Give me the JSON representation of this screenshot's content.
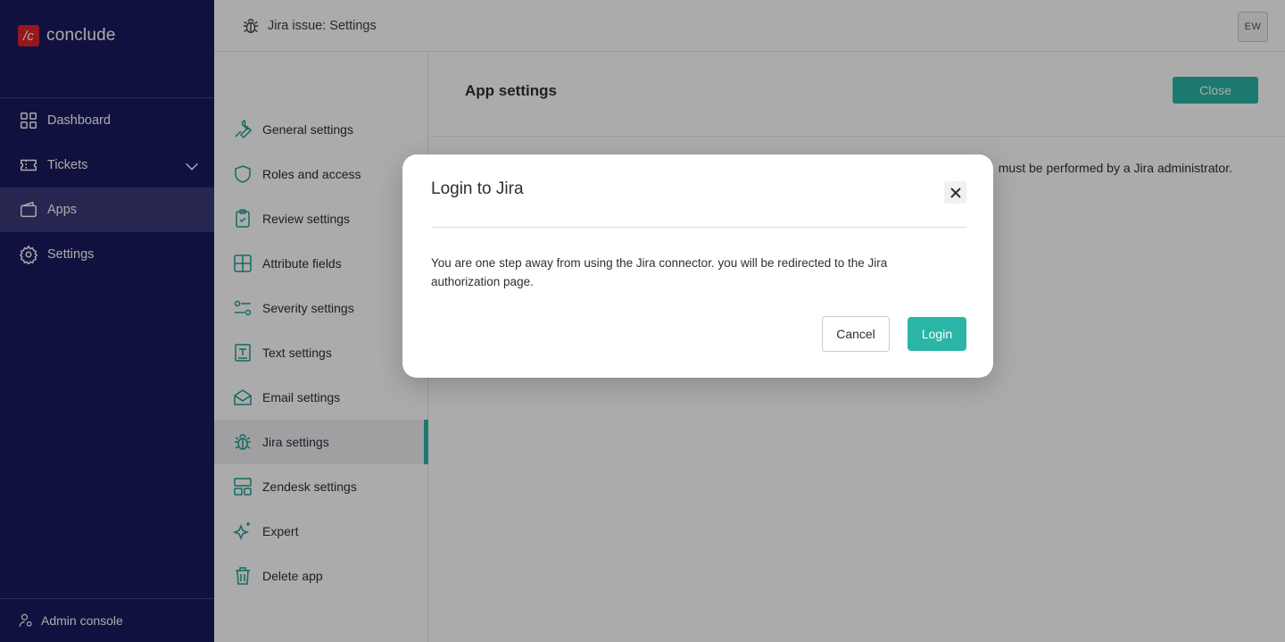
{
  "brand": {
    "mark": "/c",
    "name": "conclude"
  },
  "nav": {
    "items": [
      {
        "label": "Dashboard",
        "icon": "grid-icon"
      },
      {
        "label": "Tickets",
        "icon": "ticket-icon"
      },
      {
        "label": "Apps",
        "icon": "wallet-icon"
      },
      {
        "label": "Settings",
        "icon": "gear-icon"
      }
    ],
    "admin_label": "Admin console"
  },
  "topbar": {
    "title": "Jira issue: Settings",
    "avatar": "EW"
  },
  "subnav": {
    "items": [
      {
        "label": "General settings",
        "icon": "wrench-icon"
      },
      {
        "label": "Roles and access",
        "icon": "shield-icon"
      },
      {
        "label": "Review settings",
        "icon": "clipboard-check-icon"
      },
      {
        "label": "Attribute fields",
        "icon": "table-icon"
      },
      {
        "label": "Severity settings",
        "icon": "sliders-icon"
      },
      {
        "label": "Text settings",
        "icon": "text-icon"
      },
      {
        "label": "Email settings",
        "icon": "envelope-icon"
      },
      {
        "label": "Jira settings",
        "icon": "bug-icon"
      },
      {
        "label": "Zendesk settings",
        "icon": "layout-icon"
      },
      {
        "label": "Expert",
        "icon": "sparkle-icon"
      },
      {
        "label": "Delete app",
        "icon": "trash-icon"
      }
    ]
  },
  "main": {
    "title": "App settings",
    "close_label": "Close",
    "partial_text": "must be performed by a Jira administrator."
  },
  "modal": {
    "title": "Login to Jira",
    "body": "You are one step away from using the Jira connector. you will be redirected to the Jira authorization page.",
    "cancel_label": "Cancel",
    "login_label": "Login"
  },
  "colors": {
    "nav_bg": "#1a1a5e",
    "accent": "#2bb5a6",
    "brand_red": "#e0242c"
  }
}
